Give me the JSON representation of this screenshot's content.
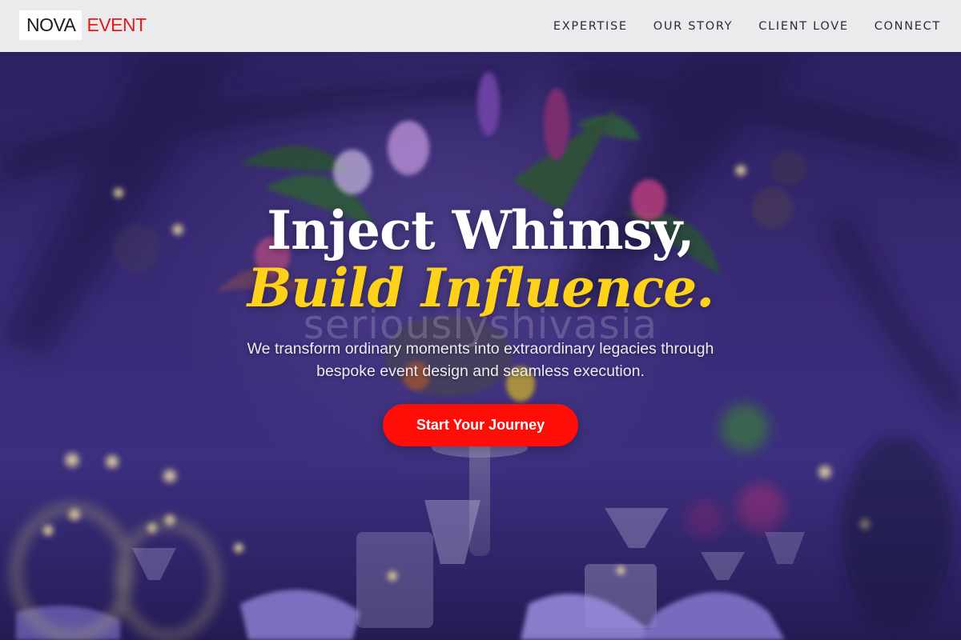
{
  "brand": {
    "name_part1": "NOVA",
    "name_part2": "EVENT",
    "accent_color": "#e11b1b"
  },
  "nav": {
    "items": [
      {
        "label": "EXPERTISE"
      },
      {
        "label": "OUR STORY"
      },
      {
        "label": "CLIENT LOVE"
      },
      {
        "label": "CONNECT"
      }
    ]
  },
  "hero": {
    "headline_line1": "Inject Whimsy,",
    "headline_line2": "Build Influence.",
    "watermark": "seriouslyshivasia",
    "subtext": "We transform ordinary moments into extraordinary legacies through bespoke event design and seamless execution.",
    "cta_label": "Start Your Journey",
    "cta_color": "#ff0e08",
    "highlight_color": "#ffd21a",
    "background_image": "event-table-centerpiece-purple-lighting"
  }
}
